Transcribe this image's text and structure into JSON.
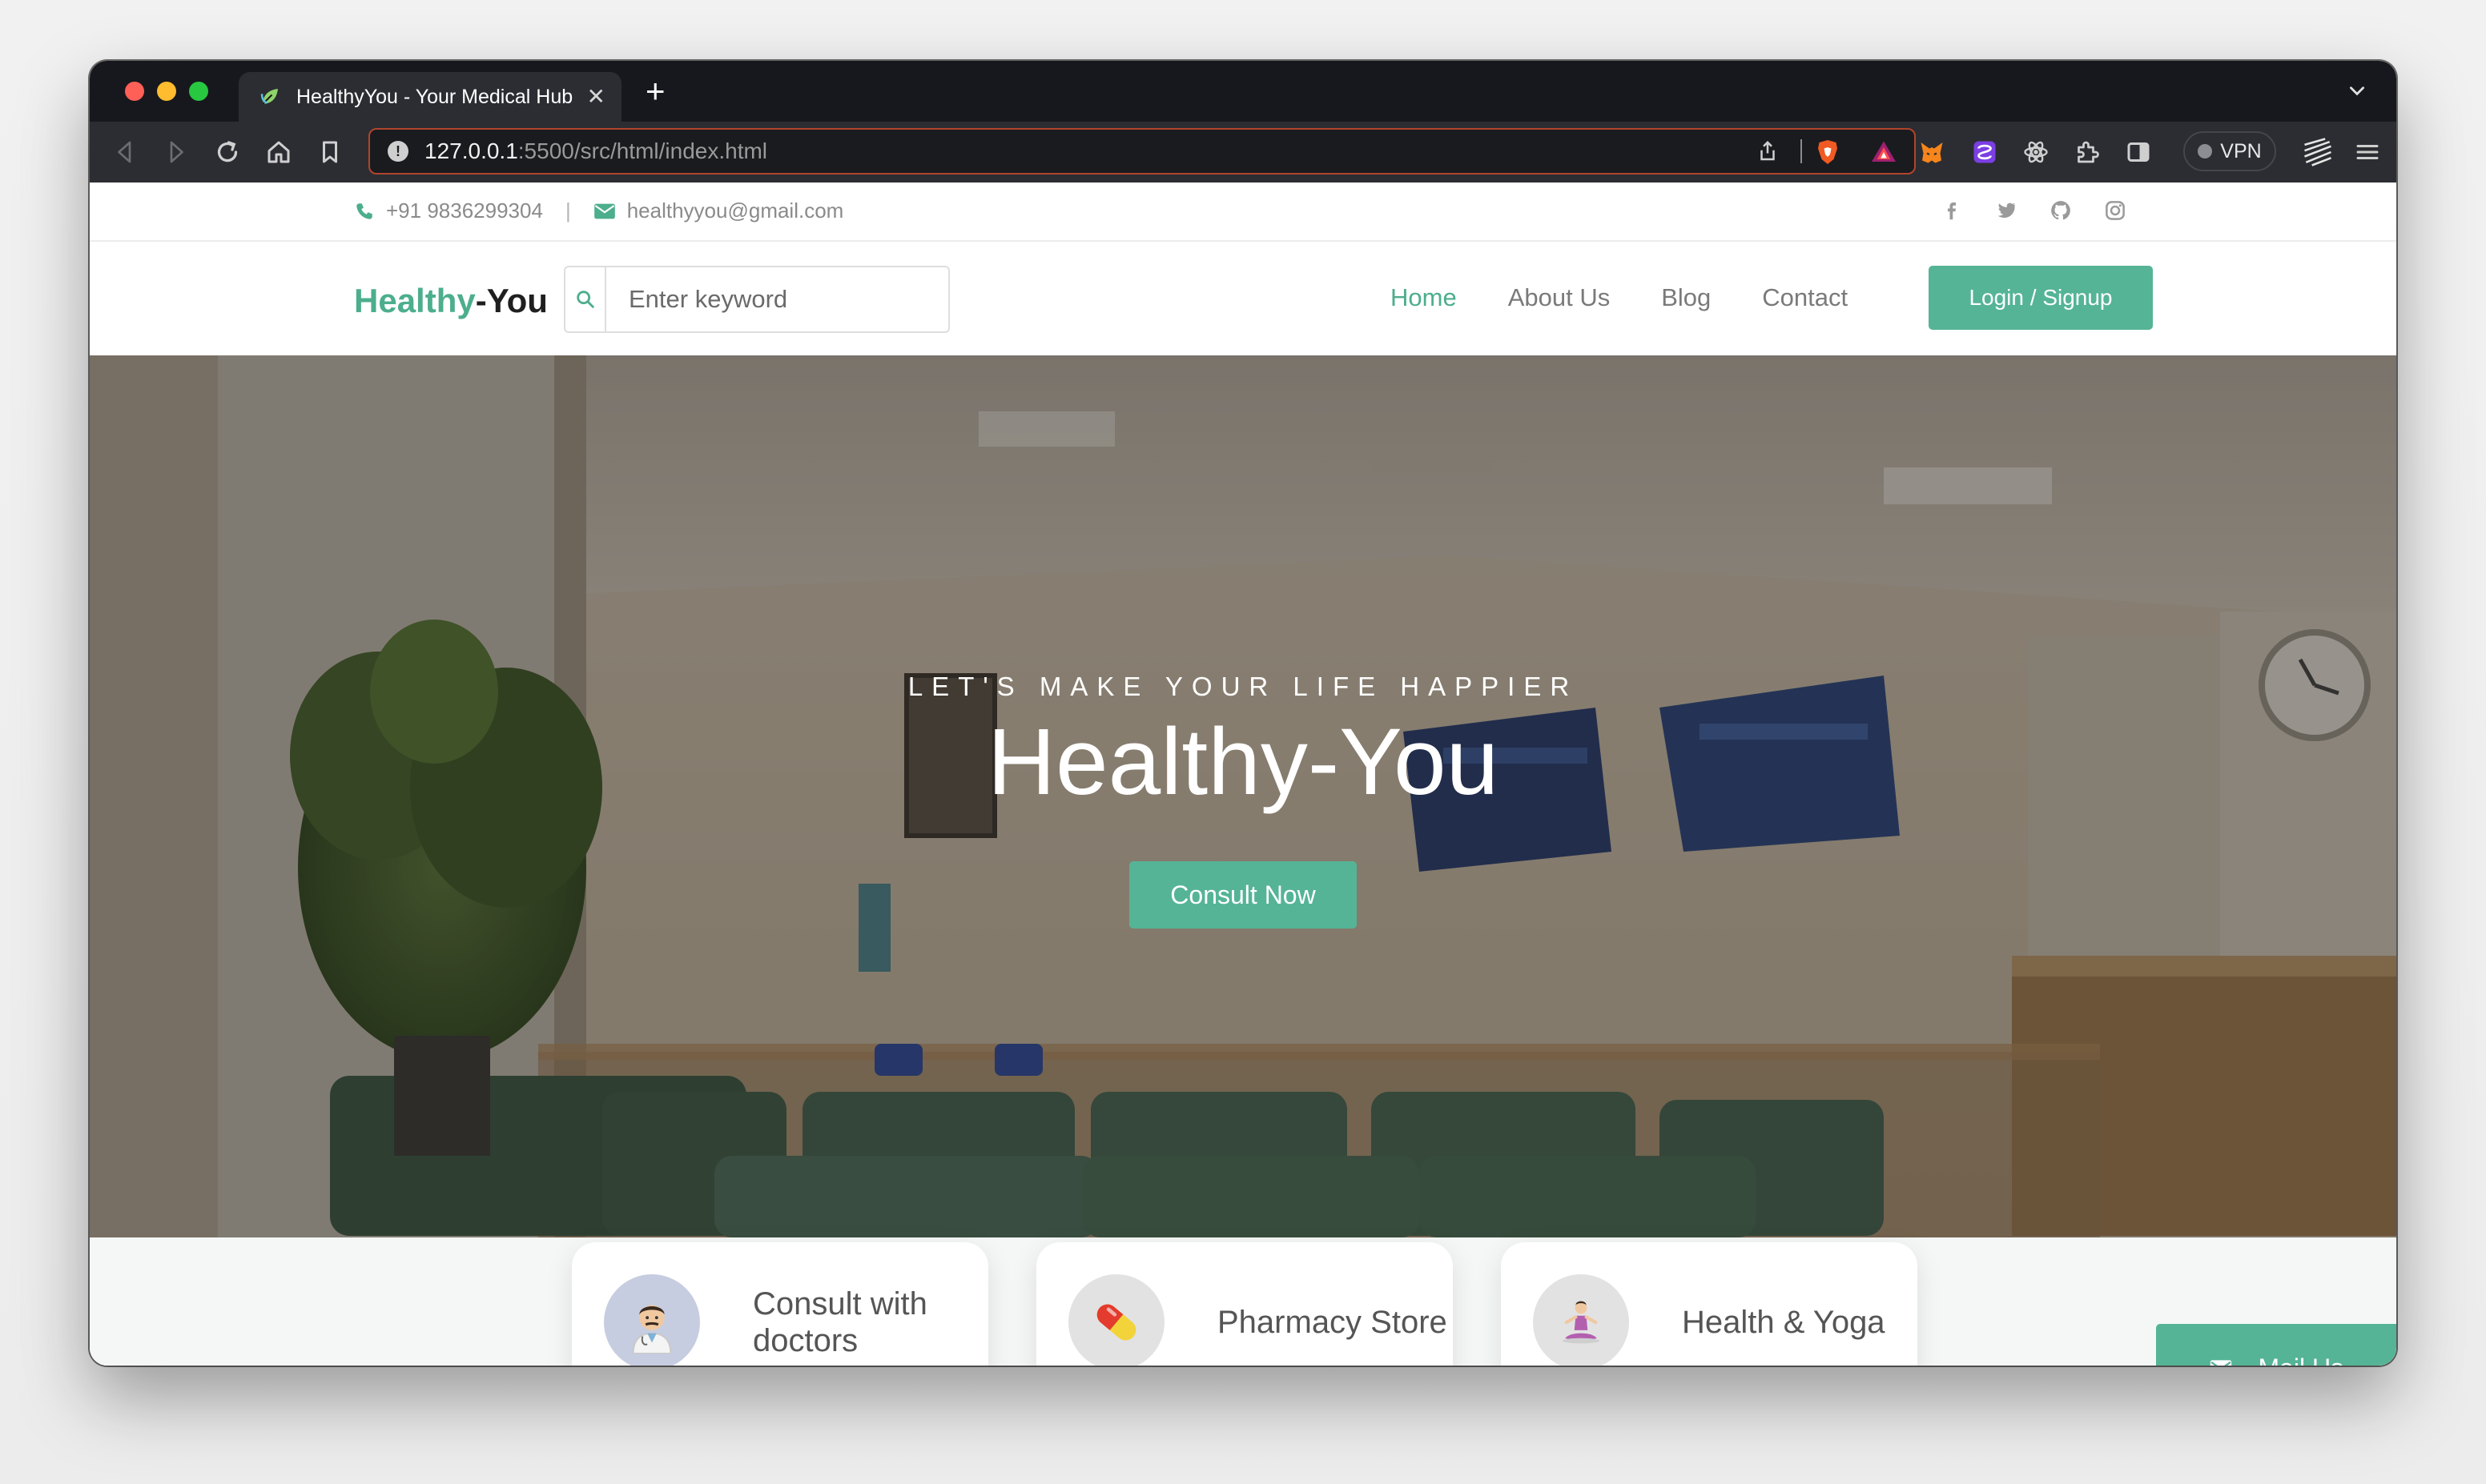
{
  "browser": {
    "tab_title": "HealthyYou - Your Medical Hub",
    "url_host": "127.0.0.1",
    "url_rest": ":5500/src/html/index.html",
    "vpn_label": "VPN"
  },
  "topbar": {
    "phone": "+91 9836299304",
    "separator": "|",
    "email": "healthyyou@gmail.com",
    "socials": [
      "facebook-icon",
      "twitter-icon",
      "github-icon",
      "instagram-icon"
    ]
  },
  "navbar": {
    "brand_first": "Healthy",
    "brand_second": "-You",
    "search_placeholder": "Enter keyword",
    "links": [
      "Home",
      "About Us",
      "Blog",
      "Contact"
    ],
    "active_link": "Home",
    "login_label": "Login / Signup"
  },
  "hero": {
    "tagline": "LET'S MAKE YOUR LIFE HAPPIER",
    "title": "Healthy-You",
    "cta_label": "Consult Now"
  },
  "features": [
    {
      "label": "Consult with doctors",
      "icon": "doctor-icon"
    },
    {
      "label": "Pharmacy Store",
      "icon": "pill-icon"
    },
    {
      "label": "Health & Yoga",
      "icon": "yoga-icon"
    }
  ],
  "mail_button": {
    "label": "- Mail Us"
  },
  "colors": {
    "brand_green": "#55b496",
    "accent_text": "#4cae8c",
    "chrome_dark": "#17181d"
  }
}
